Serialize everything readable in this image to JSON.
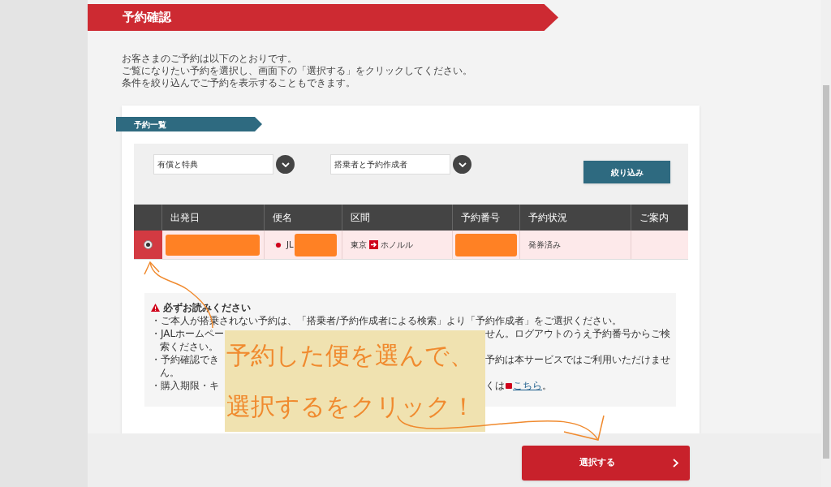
{
  "page_title": "予約確認",
  "intro": [
    "お客さまのご予約は以下のとおりです。",
    "ご覧になりたい予約を選択し、画面下の「選択する」をクリックしてください。",
    "条件を絞り込んでご予約を表示することもできます。"
  ],
  "section_title": "予約一覧",
  "filters": [
    {
      "value": "有償と特典"
    },
    {
      "value": "搭乗者と予約作成者"
    }
  ],
  "filter_button": "絞り込み",
  "table": {
    "columns": [
      "出発日",
      "便名",
      "区間",
      "予約番号",
      "予約状況",
      "ご案内"
    ],
    "rows": [
      {
        "selected": true,
        "flight": "JL",
        "route_from": "東京",
        "route_to": "ホノルル",
        "status": "発券済み"
      }
    ]
  },
  "notice": {
    "title": "必ずお読みください",
    "items": [
      {
        "kind": "full",
        "text": "・ご本人が搭乗されない予約は、「搭乗者/予約作成者による検索」より「予約作成者」をご選択ください。"
      },
      {
        "kind": "covered",
        "start": "・JALホームペー",
        "end": "せん。ログアウトのうえ予約番号からご検",
        "cont": "索ください。"
      },
      {
        "kind": "covered",
        "start": "・予約確認でき",
        "end": "予約は本サービスではご利用いただけませ",
        "cont": "ん。"
      },
      {
        "kind": "covered",
        "start": "・購入期限・キ",
        "end": "くは",
        "link": "こちら",
        "tail": "。"
      }
    ]
  },
  "overlay": {
    "lines": [
      "予約した便を選んで、",
      "選択するをクリック！"
    ]
  },
  "select_button": "選択する"
}
